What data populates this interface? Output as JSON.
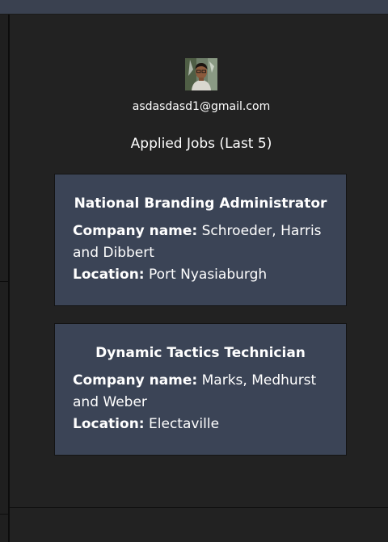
{
  "profile": {
    "email": "asdasdasd1@gmail.com",
    "avatar_icon": "user-photo"
  },
  "applied_jobs": {
    "title": "Applied Jobs (Last 5)",
    "company_label": "Company name:",
    "location_label": "Location:",
    "jobs": [
      {
        "title": "National Branding Administrator",
        "company": "Schroeder, Harris and Dibbert",
        "location": "Port Nyasiaburgh"
      },
      {
        "title": "Dynamic Tactics Technician",
        "company": "Marks, Medhurst and Weber",
        "location": "Electaville"
      }
    ]
  },
  "colors": {
    "background": "#222222",
    "card": "#3b4456",
    "topbar": "#3a4150"
  }
}
